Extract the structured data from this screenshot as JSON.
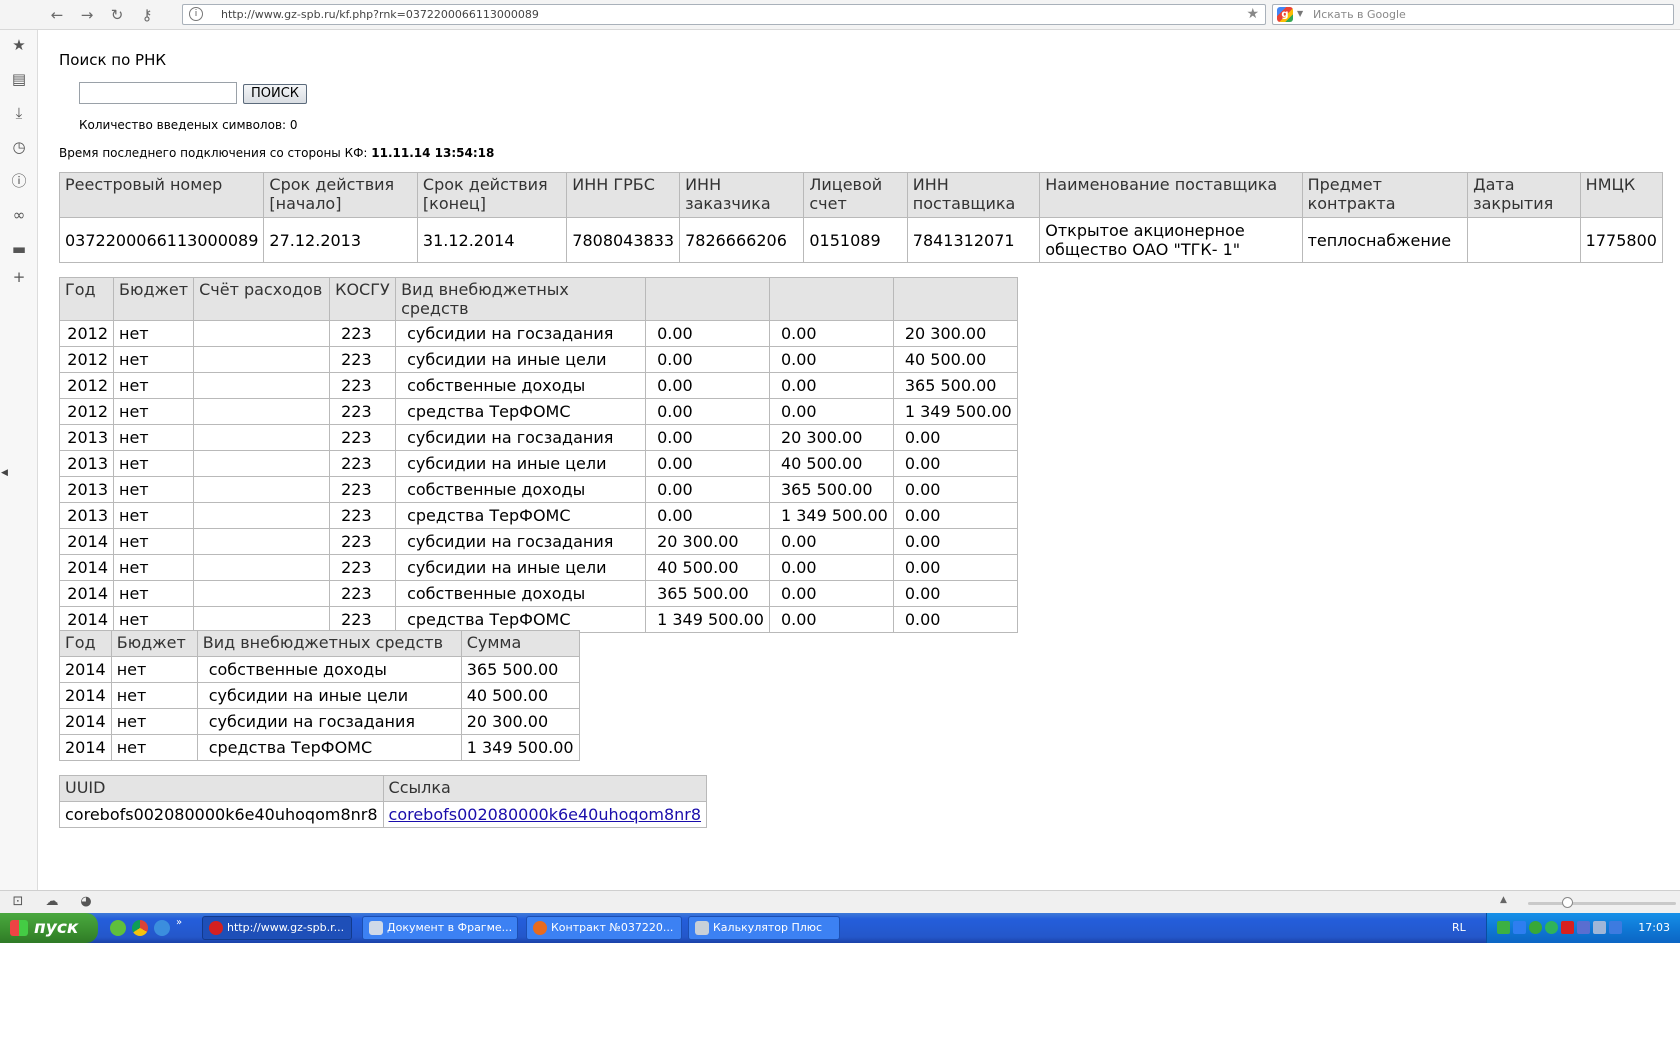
{
  "browser": {
    "url": "http://www.gz-spb.ru/kf.php?rnk=0372200066113000089",
    "search_placeholder": "Искать в Google"
  },
  "page": {
    "title": "Поиск по РНК",
    "search_input_value": "",
    "search_button": "ПОИСК",
    "char_count_text": "Количество введеных символов: 0",
    "last_connection_label": "Время последнего подключения со стороны КФ: ",
    "last_connection_value": "11.11.14 13:54:18"
  },
  "contract_table": {
    "headers": [
      "Реестровый номер",
      "Срок действия [начало]",
      "Срок действия [конец]",
      "ИНН ГРБС",
      "ИНН заказчика",
      "Лицевой счет",
      "ИНН поставщика",
      "Наименование поставщика",
      "Предмет контракта",
      "Дата закрытия",
      "НМЦК"
    ],
    "row": [
      "0372200066113000089",
      "27.12.2013",
      "31.12.2014",
      "7808043833",
      "7826666206",
      "0151089",
      "7841312071",
      "Открытое акционерное общество ОАО \"ТГК- 1\"",
      "теплоснабжение",
      "",
      "1775800"
    ]
  },
  "budget_table": {
    "headers": [
      "Год",
      "Бюджет",
      "Счёт расходов",
      "КОСГУ",
      "Вид внебюджетных средств",
      "",
      "",
      ""
    ],
    "rows": [
      [
        "2012",
        "нет",
        "",
        "223",
        "субсидии на госзадания",
        "0.00",
        "0.00",
        "20 300.00"
      ],
      [
        "2012",
        "нет",
        "",
        "223",
        "субсидии на иные цели",
        "0.00",
        "0.00",
        "40 500.00"
      ],
      [
        "2012",
        "нет",
        "",
        "223",
        "собственные доходы",
        "0.00",
        "0.00",
        "365 500.00"
      ],
      [
        "2012",
        "нет",
        "",
        "223",
        "средства ТерФОМС",
        "0.00",
        "0.00",
        "1 349 500.00"
      ],
      [
        "2013",
        "нет",
        "",
        "223",
        "субсидии на госзадания",
        "0.00",
        "20 300.00",
        "0.00"
      ],
      [
        "2013",
        "нет",
        "",
        "223",
        "субсидии на иные цели",
        "0.00",
        "40 500.00",
        "0.00"
      ],
      [
        "2013",
        "нет",
        "",
        "223",
        "собственные доходы",
        "0.00",
        "365 500.00",
        "0.00"
      ],
      [
        "2013",
        "нет",
        "",
        "223",
        "средства ТерФОМС",
        "0.00",
        "1 349 500.00",
        "0.00"
      ],
      [
        "2014",
        "нет",
        "",
        "223",
        "субсидии на госзадания",
        "20 300.00",
        "0.00",
        "0.00"
      ],
      [
        "2014",
        "нет",
        "",
        "223",
        "субсидии на иные цели",
        "40 500.00",
        "0.00",
        "0.00"
      ],
      [
        "2014",
        "нет",
        "",
        "223",
        "собственные доходы",
        "365 500.00",
        "0.00",
        "0.00"
      ],
      [
        "2014",
        "нет",
        "",
        "223",
        "средства ТерФОМС",
        "1 349 500.00",
        "0.00",
        "0.00"
      ]
    ]
  },
  "summary_table": {
    "headers": [
      "Год",
      "Бюджет",
      "Вид внебюджетных средств",
      "Сумма"
    ],
    "rows": [
      [
        "2014",
        "нет",
        "собственные доходы",
        "365 500.00"
      ],
      [
        "2014",
        "нет",
        "субсидии на иные цели",
        "40 500.00"
      ],
      [
        "2014",
        "нет",
        "субсидии на госзадания",
        "20 300.00"
      ],
      [
        "2014",
        "нет",
        "средства ТерФОМС",
        "1 349 500.00"
      ]
    ]
  },
  "uuid_table": {
    "headers": [
      "UUID",
      "Ссылка"
    ],
    "uuid": "corebofs002080000k6e40uhoqom8nr8",
    "link": "corebofs002080000k6e40uhoqom8nr8"
  },
  "taskbar": {
    "start": "пуск",
    "tasks": [
      "http://www.gz-spb.r...",
      "Документ в Фрагме...",
      "Контракт №037220...",
      "Калькулятор Плюс"
    ],
    "lang": "RL",
    "clock": "17:03"
  },
  "colors": {
    "header_bg": "#e4e4e4",
    "border": "#b9b9b9",
    "link": "#1a0dab",
    "taskbar": "#245edb",
    "start_green": "#3a8f2f"
  }
}
